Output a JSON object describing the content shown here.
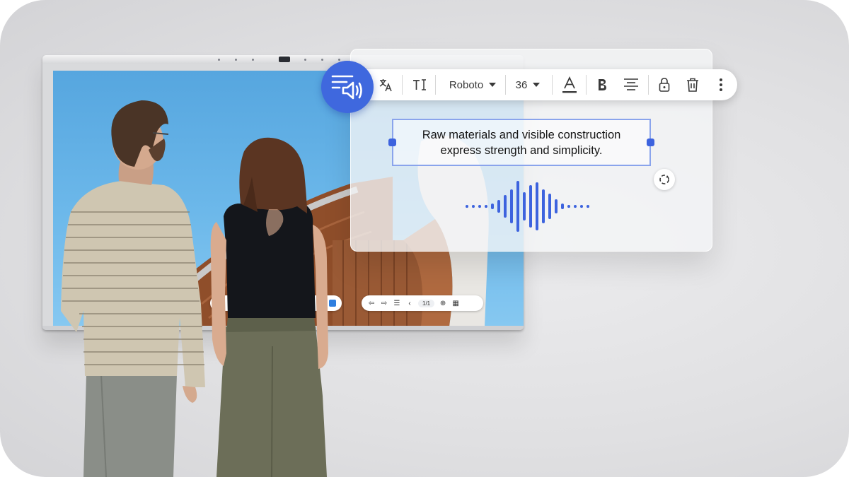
{
  "toolbar": {
    "font_family": "Roboto",
    "font_size": "36",
    "icons": [
      "text-to-speech-icon",
      "translate-icon",
      "text-type-icon",
      "font-color-icon",
      "bold-icon",
      "align-icon",
      "lock-icon",
      "delete-icon",
      "more-icon"
    ]
  },
  "text_box": {
    "line1": "Raw materials and visible construction",
    "line2": "express strength and simplicity."
  },
  "whiteboard": {
    "page_indicator": "1/1"
  },
  "colors": {
    "accent": "#3f68de",
    "selection_border": "#8aa4ec",
    "waveform": "#3d63de"
  }
}
